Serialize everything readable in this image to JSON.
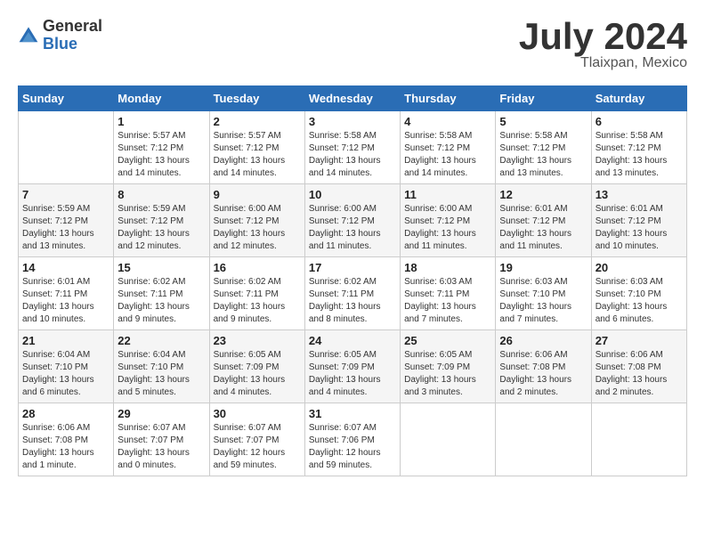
{
  "logo": {
    "general": "General",
    "blue": "Blue"
  },
  "title": {
    "month": "July 2024",
    "location": "Tlaixpan, Mexico"
  },
  "weekdays": [
    "Sunday",
    "Monday",
    "Tuesday",
    "Wednesday",
    "Thursday",
    "Friday",
    "Saturday"
  ],
  "weeks": [
    [
      {
        "day": "",
        "sunrise": "",
        "sunset": "",
        "daylight": ""
      },
      {
        "day": "1",
        "sunrise": "Sunrise: 5:57 AM",
        "sunset": "Sunset: 7:12 PM",
        "daylight": "Daylight: 13 hours and 14 minutes."
      },
      {
        "day": "2",
        "sunrise": "Sunrise: 5:57 AM",
        "sunset": "Sunset: 7:12 PM",
        "daylight": "Daylight: 13 hours and 14 minutes."
      },
      {
        "day": "3",
        "sunrise": "Sunrise: 5:58 AM",
        "sunset": "Sunset: 7:12 PM",
        "daylight": "Daylight: 13 hours and 14 minutes."
      },
      {
        "day": "4",
        "sunrise": "Sunrise: 5:58 AM",
        "sunset": "Sunset: 7:12 PM",
        "daylight": "Daylight: 13 hours and 14 minutes."
      },
      {
        "day": "5",
        "sunrise": "Sunrise: 5:58 AM",
        "sunset": "Sunset: 7:12 PM",
        "daylight": "Daylight: 13 hours and 13 minutes."
      },
      {
        "day": "6",
        "sunrise": "Sunrise: 5:58 AM",
        "sunset": "Sunset: 7:12 PM",
        "daylight": "Daylight: 13 hours and 13 minutes."
      }
    ],
    [
      {
        "day": "7",
        "sunrise": "Sunrise: 5:59 AM",
        "sunset": "Sunset: 7:12 PM",
        "daylight": "Daylight: 13 hours and 13 minutes."
      },
      {
        "day": "8",
        "sunrise": "Sunrise: 5:59 AM",
        "sunset": "Sunset: 7:12 PM",
        "daylight": "Daylight: 13 hours and 12 minutes."
      },
      {
        "day": "9",
        "sunrise": "Sunrise: 6:00 AM",
        "sunset": "Sunset: 7:12 PM",
        "daylight": "Daylight: 13 hours and 12 minutes."
      },
      {
        "day": "10",
        "sunrise": "Sunrise: 6:00 AM",
        "sunset": "Sunset: 7:12 PM",
        "daylight": "Daylight: 13 hours and 11 minutes."
      },
      {
        "day": "11",
        "sunrise": "Sunrise: 6:00 AM",
        "sunset": "Sunset: 7:12 PM",
        "daylight": "Daylight: 13 hours and 11 minutes."
      },
      {
        "day": "12",
        "sunrise": "Sunrise: 6:01 AM",
        "sunset": "Sunset: 7:12 PM",
        "daylight": "Daylight: 13 hours and 11 minutes."
      },
      {
        "day": "13",
        "sunrise": "Sunrise: 6:01 AM",
        "sunset": "Sunset: 7:12 PM",
        "daylight": "Daylight: 13 hours and 10 minutes."
      }
    ],
    [
      {
        "day": "14",
        "sunrise": "Sunrise: 6:01 AM",
        "sunset": "Sunset: 7:11 PM",
        "daylight": "Daylight: 13 hours and 10 minutes."
      },
      {
        "day": "15",
        "sunrise": "Sunrise: 6:02 AM",
        "sunset": "Sunset: 7:11 PM",
        "daylight": "Daylight: 13 hours and 9 minutes."
      },
      {
        "day": "16",
        "sunrise": "Sunrise: 6:02 AM",
        "sunset": "Sunset: 7:11 PM",
        "daylight": "Daylight: 13 hours and 9 minutes."
      },
      {
        "day": "17",
        "sunrise": "Sunrise: 6:02 AM",
        "sunset": "Sunset: 7:11 PM",
        "daylight": "Daylight: 13 hours and 8 minutes."
      },
      {
        "day": "18",
        "sunrise": "Sunrise: 6:03 AM",
        "sunset": "Sunset: 7:11 PM",
        "daylight": "Daylight: 13 hours and 7 minutes."
      },
      {
        "day": "19",
        "sunrise": "Sunrise: 6:03 AM",
        "sunset": "Sunset: 7:10 PM",
        "daylight": "Daylight: 13 hours and 7 minutes."
      },
      {
        "day": "20",
        "sunrise": "Sunrise: 6:03 AM",
        "sunset": "Sunset: 7:10 PM",
        "daylight": "Daylight: 13 hours and 6 minutes."
      }
    ],
    [
      {
        "day": "21",
        "sunrise": "Sunrise: 6:04 AM",
        "sunset": "Sunset: 7:10 PM",
        "daylight": "Daylight: 13 hours and 6 minutes."
      },
      {
        "day": "22",
        "sunrise": "Sunrise: 6:04 AM",
        "sunset": "Sunset: 7:10 PM",
        "daylight": "Daylight: 13 hours and 5 minutes."
      },
      {
        "day": "23",
        "sunrise": "Sunrise: 6:05 AM",
        "sunset": "Sunset: 7:09 PM",
        "daylight": "Daylight: 13 hours and 4 minutes."
      },
      {
        "day": "24",
        "sunrise": "Sunrise: 6:05 AM",
        "sunset": "Sunset: 7:09 PM",
        "daylight": "Daylight: 13 hours and 4 minutes."
      },
      {
        "day": "25",
        "sunrise": "Sunrise: 6:05 AM",
        "sunset": "Sunset: 7:09 PM",
        "daylight": "Daylight: 13 hours and 3 minutes."
      },
      {
        "day": "26",
        "sunrise": "Sunrise: 6:06 AM",
        "sunset": "Sunset: 7:08 PM",
        "daylight": "Daylight: 13 hours and 2 minutes."
      },
      {
        "day": "27",
        "sunrise": "Sunrise: 6:06 AM",
        "sunset": "Sunset: 7:08 PM",
        "daylight": "Daylight: 13 hours and 2 minutes."
      }
    ],
    [
      {
        "day": "28",
        "sunrise": "Sunrise: 6:06 AM",
        "sunset": "Sunset: 7:08 PM",
        "daylight": "Daylight: 13 hours and 1 minute."
      },
      {
        "day": "29",
        "sunrise": "Sunrise: 6:07 AM",
        "sunset": "Sunset: 7:07 PM",
        "daylight": "Daylight: 13 hours and 0 minutes."
      },
      {
        "day": "30",
        "sunrise": "Sunrise: 6:07 AM",
        "sunset": "Sunset: 7:07 PM",
        "daylight": "Daylight: 12 hours and 59 minutes."
      },
      {
        "day": "31",
        "sunrise": "Sunrise: 6:07 AM",
        "sunset": "Sunset: 7:06 PM",
        "daylight": "Daylight: 12 hours and 59 minutes."
      },
      {
        "day": "",
        "sunrise": "",
        "sunset": "",
        "daylight": ""
      },
      {
        "day": "",
        "sunrise": "",
        "sunset": "",
        "daylight": ""
      },
      {
        "day": "",
        "sunrise": "",
        "sunset": "",
        "daylight": ""
      }
    ]
  ]
}
